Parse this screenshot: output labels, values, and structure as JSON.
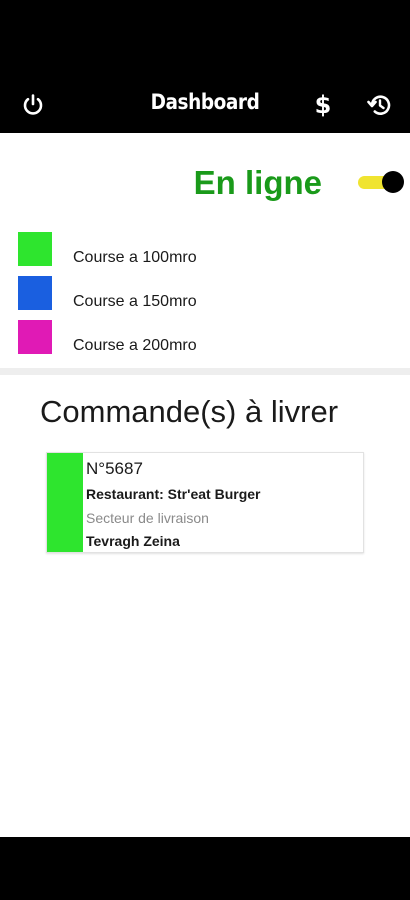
{
  "toolbar": {
    "title": "Dashboard",
    "power_icon": "power-icon",
    "dollar_icon": "$",
    "history_icon": "history-icon"
  },
  "status": {
    "label": "En ligne",
    "online": true,
    "color": "#1a9a1a",
    "toggle_track_color": "#f0e430",
    "toggle_knob_color": "#000000"
  },
  "legend": [
    {
      "label": "Course a 100mro",
      "color": "#2ee52e"
    },
    {
      "label": "Course a 150mro",
      "color": "#1a5fe0"
    },
    {
      "label": "Course a 200mro",
      "color": "#e01ab5"
    }
  ],
  "section": {
    "title": "Commande(s) à livrer"
  },
  "orders": [
    {
      "number": "N°5687",
      "restaurant": "Restaurant: Str'eat Burger",
      "sector_label": "Secteur de livraison",
      "sector": "Tevragh Zeina",
      "color": "#2ee52e"
    }
  ]
}
